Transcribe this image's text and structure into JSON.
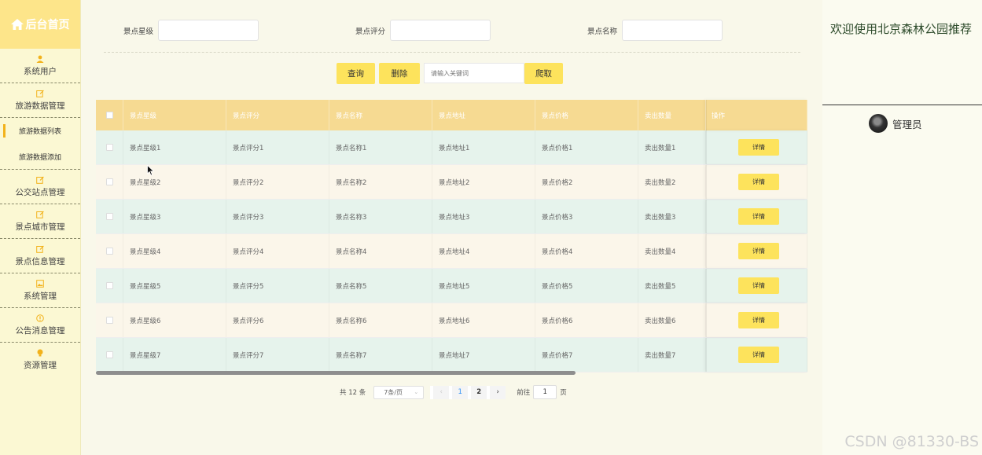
{
  "sidebar": {
    "brand": "后台首页",
    "items": [
      {
        "label": "系统用户",
        "icon": "user-icon"
      },
      {
        "label": "旅游数据管理",
        "icon": "edit-icon"
      },
      {
        "label": "公交站点管理",
        "icon": "edit-icon"
      },
      {
        "label": "景点城市管理",
        "icon": "edit-icon"
      },
      {
        "label": "景点信息管理",
        "icon": "edit-icon"
      },
      {
        "label": "系统管理",
        "icon": "image-icon"
      },
      {
        "label": "公告消息管理",
        "icon": "info-icon"
      },
      {
        "label": "资源管理",
        "icon": "bulb-icon"
      }
    ],
    "subitems": [
      {
        "label": "旅游数据列表",
        "active": true
      },
      {
        "label": "旅游数据添加",
        "active": false
      }
    ]
  },
  "search": {
    "field1_label": "景点星级",
    "field2_label": "景点评分",
    "field3_label": "景点名称",
    "query_button": "查询",
    "delete_button": "删除",
    "keyword_placeholder": "请输入关键词",
    "crawl_button": "爬取"
  },
  "table": {
    "headers": [
      "景点星级",
      "景点评分",
      "景点名称",
      "景点地址",
      "景点价格",
      "卖出数量",
      "操作"
    ],
    "rows": [
      [
        "景点星级1",
        "景点评分1",
        "景点名称1",
        "景点地址1",
        "景点价格1",
        "卖出数量1"
      ],
      [
        "景点星级2",
        "景点评分2",
        "景点名称2",
        "景点地址2",
        "景点价格2",
        "卖出数量2"
      ],
      [
        "景点星级3",
        "景点评分3",
        "景点名称3",
        "景点地址3",
        "景点价格3",
        "卖出数量3"
      ],
      [
        "景点星级4",
        "景点评分4",
        "景点名称4",
        "景点地址4",
        "景点价格4",
        "卖出数量4"
      ],
      [
        "景点星级5",
        "景点评分5",
        "景点名称5",
        "景点地址5",
        "景点价格5",
        "卖出数量5"
      ],
      [
        "景点星级6",
        "景点评分6",
        "景点名称6",
        "景点地址6",
        "景点价格6",
        "卖出数量6"
      ],
      [
        "景点星级7",
        "景点评分7",
        "景点名称7",
        "景点地址7",
        "景点价格7",
        "卖出数量7"
      ]
    ],
    "detail_label": "详情"
  },
  "pagination": {
    "total": "共 12 条",
    "page_size": "7条/页",
    "pages": [
      "1",
      "2"
    ],
    "current": "1",
    "goto_prefix": "前往",
    "goto_value": "1",
    "goto_suffix": "页"
  },
  "right": {
    "welcome": "欢迎使用北京森林公园推荐",
    "username": "管理员"
  },
  "watermark": "CSDN @81330-BS",
  "colors": {
    "accent": "#fde35c",
    "header": "#f6da92",
    "sidebar": "#fbf8d3",
    "row_odd": "#e6f3ec",
    "row_even": "#fbf6ea"
  }
}
